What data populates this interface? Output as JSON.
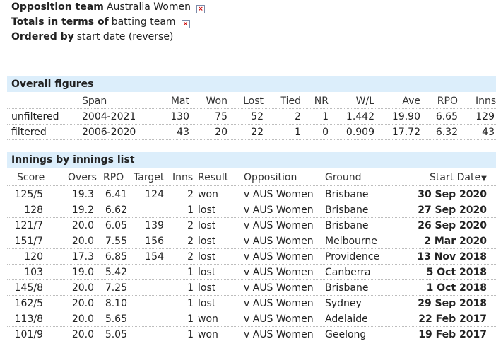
{
  "filters": [
    {
      "label": "Opposition team",
      "value": "Australia Women",
      "removable": true
    },
    {
      "label": "Totals in terms of",
      "value": "batting team",
      "removable": true
    },
    {
      "label": "Ordered by",
      "value": "start date (reverse)",
      "removable": false
    }
  ],
  "remove_icon_glyph": "×",
  "overall": {
    "title": "Overall figures",
    "headers": [
      "",
      "Span",
      "Mat",
      "Won",
      "Lost",
      "Tied",
      "NR",
      "W/L",
      "Ave",
      "RPO",
      "Inns"
    ],
    "rows": [
      [
        "unfiltered",
        "2004-2021",
        "130",
        "75",
        "52",
        "2",
        "1",
        "1.442",
        "19.90",
        "6.65",
        "129"
      ],
      [
        "filtered",
        "2006-2020",
        "43",
        "20",
        "22",
        "1",
        "0",
        "0.909",
        "17.72",
        "6.32",
        "43"
      ]
    ]
  },
  "innings": {
    "title": "Innings by innings list",
    "headers": [
      "Score",
      "Overs",
      "RPO",
      "Target",
      "Inns",
      "Result",
      "Opposition",
      "Ground",
      "Start Date"
    ],
    "sort_icon": "▼",
    "rows": [
      [
        "125/5",
        "19.3",
        "6.41",
        "124",
        "2",
        "won",
        "v AUS Women",
        "Brisbane",
        "30 Sep 2020"
      ],
      [
        "128",
        "19.2",
        "6.62",
        "",
        "1",
        "lost",
        "v AUS Women",
        "Brisbane",
        "27 Sep 2020"
      ],
      [
        "121/7",
        "20.0",
        "6.05",
        "139",
        "2",
        "lost",
        "v AUS Women",
        "Brisbane",
        "26 Sep 2020"
      ],
      [
        "151/7",
        "20.0",
        "7.55",
        "156",
        "2",
        "lost",
        "v AUS Women",
        "Melbourne",
        "2 Mar 2020"
      ],
      [
        "120",
        "17.3",
        "6.85",
        "154",
        "2",
        "lost",
        "v AUS Women",
        "Providence",
        "13 Nov 2018"
      ],
      [
        "103",
        "19.0",
        "5.42",
        "",
        "1",
        "lost",
        "v AUS Women",
        "Canberra",
        "5 Oct 2018"
      ],
      [
        "145/8",
        "20.0",
        "7.25",
        "",
        "1",
        "lost",
        "v AUS Women",
        "Brisbane",
        "1 Oct 2018"
      ],
      [
        "162/5",
        "20.0",
        "8.10",
        "",
        "1",
        "lost",
        "v AUS Women",
        "Sydney",
        "29 Sep 2018"
      ],
      [
        "113/8",
        "20.0",
        "5.65",
        "",
        "1",
        "won",
        "v AUS Women",
        "Adelaide",
        "22 Feb 2017"
      ],
      [
        "101/9",
        "20.0",
        "5.05",
        "",
        "1",
        "won",
        "v AUS Women",
        "Geelong",
        "19 Feb 2017"
      ]
    ]
  }
}
